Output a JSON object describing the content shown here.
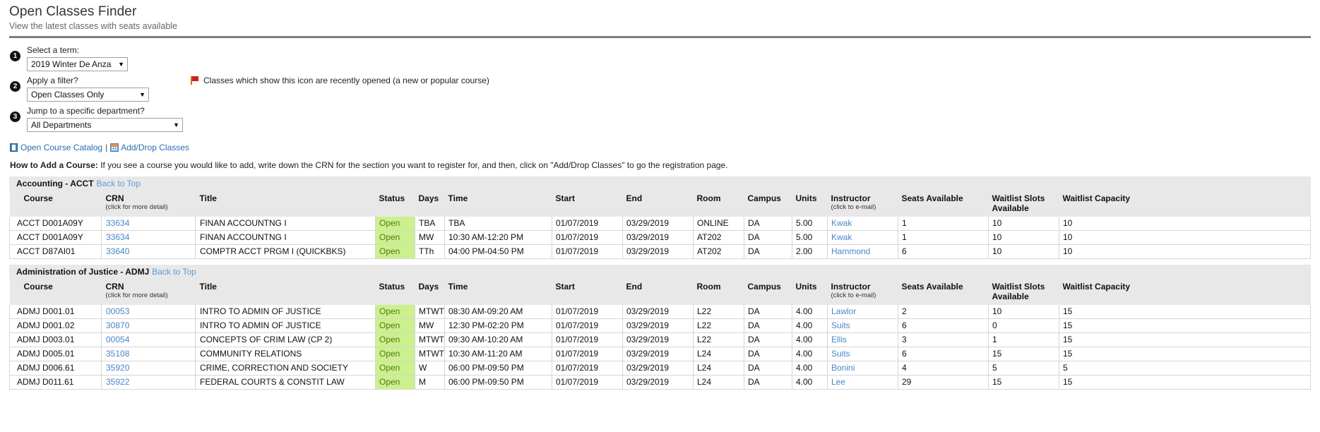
{
  "header": {
    "title": "Open Classes Finder",
    "subtitle": "View the latest classes with seats available"
  },
  "controls": {
    "step1": {
      "number": "1",
      "label": "Select a term:",
      "value": "2019 Winter De Anza",
      "caret": "▼"
    },
    "step2": {
      "number": "2",
      "label": "Apply a filter?",
      "value": "Open Classes Only",
      "caret": "▼"
    },
    "step3": {
      "number": "3",
      "label": "Jump to a specific department?",
      "value": "All Departments",
      "caret": "▼"
    },
    "flag_note": "Classes which show this icon are recently opened (a new or popular course)"
  },
  "links": {
    "catalog": "Open Course Catalog",
    "separator": "|",
    "add_drop": "Add/Drop Classes"
  },
  "howto": {
    "label": "How to Add a Course:",
    "text": " If you see a course you would like to add, write down the CRN for the section you want to register for, and then, click on \"Add/Drop Classes\" to go the registration page."
  },
  "table_headers": {
    "course": "Course",
    "crn": "CRN",
    "crn_sub": "(click for more detail)",
    "title": "Title",
    "status": "Status",
    "days": "Days",
    "time": "Time",
    "start": "Start",
    "end": "End",
    "room": "Room",
    "campus": "Campus",
    "units": "Units",
    "instructor": "Instructor",
    "instructor_sub": "(click to e-mail)",
    "seats": "Seats Available",
    "waitlist_slots": "Waitlist Slots Available",
    "waitlist_capacity": "Waitlist Capacity"
  },
  "back_to_top": "Back to Top",
  "departments": [
    {
      "name": "Accounting - ACCT",
      "rows": [
        {
          "course": "ACCT D001A09Y",
          "crn": "33634",
          "title": "FINAN ACCOUNTNG I",
          "status": "Open",
          "days": "TBA",
          "time": "TBA",
          "start": "01/07/2019",
          "end": "03/29/2019",
          "room": "ONLINE",
          "campus": "DA",
          "units": "5.00",
          "instructor": "Kwak",
          "seats": "1",
          "waitlist_slots": "10",
          "waitlist_capacity": "10"
        },
        {
          "course": "ACCT D001A09Y",
          "crn": "33634",
          "title": "FINAN ACCOUNTNG I",
          "status": "Open",
          "days": "MW",
          "time": "10:30 AM-12:20 PM",
          "start": "01/07/2019",
          "end": "03/29/2019",
          "room": "AT202",
          "campus": "DA",
          "units": "5.00",
          "instructor": "Kwak",
          "seats": "1",
          "waitlist_slots": "10",
          "waitlist_capacity": "10"
        },
        {
          "course": "ACCT D87AI01",
          "crn": "33640",
          "title": "COMPTR ACCT PRGM I (QUICKBKS)",
          "status": "Open",
          "days": "TTh",
          "time": "04:00 PM-04:50 PM",
          "start": "01/07/2019",
          "end": "03/29/2019",
          "room": "AT202",
          "campus": "DA",
          "units": "2.00",
          "instructor": "Hammond",
          "seats": "6",
          "waitlist_slots": "10",
          "waitlist_capacity": "10"
        }
      ]
    },
    {
      "name": "Administration of Justice - ADMJ",
      "rows": [
        {
          "course": "ADMJ D001.01",
          "crn": "00053",
          "title": "INTRO TO ADMIN OF JUSTICE",
          "status": "Open",
          "days": "MTWTh",
          "time": "08:30 AM-09:20 AM",
          "start": "01/07/2019",
          "end": "03/29/2019",
          "room": "L22",
          "campus": "DA",
          "units": "4.00",
          "instructor": "Lawlor",
          "seats": "2",
          "waitlist_slots": "10",
          "waitlist_capacity": "15"
        },
        {
          "course": "ADMJ D001.02",
          "crn": "30870",
          "title": "INTRO TO ADMIN OF JUSTICE",
          "status": "Open",
          "days": "MW",
          "time": "12:30 PM-02:20 PM",
          "start": "01/07/2019",
          "end": "03/29/2019",
          "room": "L22",
          "campus": "DA",
          "units": "4.00",
          "instructor": "Suits",
          "seats": "6",
          "waitlist_slots": "0",
          "waitlist_capacity": "15"
        },
        {
          "course": "ADMJ D003.01",
          "crn": "00054",
          "title": "CONCEPTS OF CRIM LAW (CP 2)",
          "status": "Open",
          "days": "MTWTh",
          "time": "09:30 AM-10:20 AM",
          "start": "01/07/2019",
          "end": "03/29/2019",
          "room": "L22",
          "campus": "DA",
          "units": "4.00",
          "instructor": "Ellis",
          "seats": "3",
          "waitlist_slots": "1",
          "waitlist_capacity": "15"
        },
        {
          "course": "ADMJ D005.01",
          "crn": "35108",
          "title": "COMMUNITY RELATIONS",
          "status": "Open",
          "days": "MTWTh",
          "time": "10:30 AM-11:20 AM",
          "start": "01/07/2019",
          "end": "03/29/2019",
          "room": "L24",
          "campus": "DA",
          "units": "4.00",
          "instructor": "Suits",
          "seats": "6",
          "waitlist_slots": "15",
          "waitlist_capacity": "15"
        },
        {
          "course": "ADMJ D006.61",
          "crn": "35920",
          "title": "CRIME, CORRECTION AND SOCIETY",
          "status": "Open",
          "days": "W",
          "time": "06:00 PM-09:50 PM",
          "start": "01/07/2019",
          "end": "03/29/2019",
          "room": "L24",
          "campus": "DA",
          "units": "4.00",
          "instructor": "Bonini",
          "seats": "4",
          "waitlist_slots": "5",
          "waitlist_capacity": "5"
        },
        {
          "course": "ADMJ D011.61",
          "crn": "35922",
          "title": "FEDERAL COURTS & CONSTIT LAW",
          "status": "Open",
          "days": "M",
          "time": "06:00 PM-09:50 PM",
          "start": "01/07/2019",
          "end": "03/29/2019",
          "room": "L24",
          "campus": "DA",
          "units": "4.00",
          "instructor": "Lee",
          "seats": "29",
          "waitlist_slots": "15",
          "waitlist_capacity": "15"
        }
      ]
    }
  ]
}
